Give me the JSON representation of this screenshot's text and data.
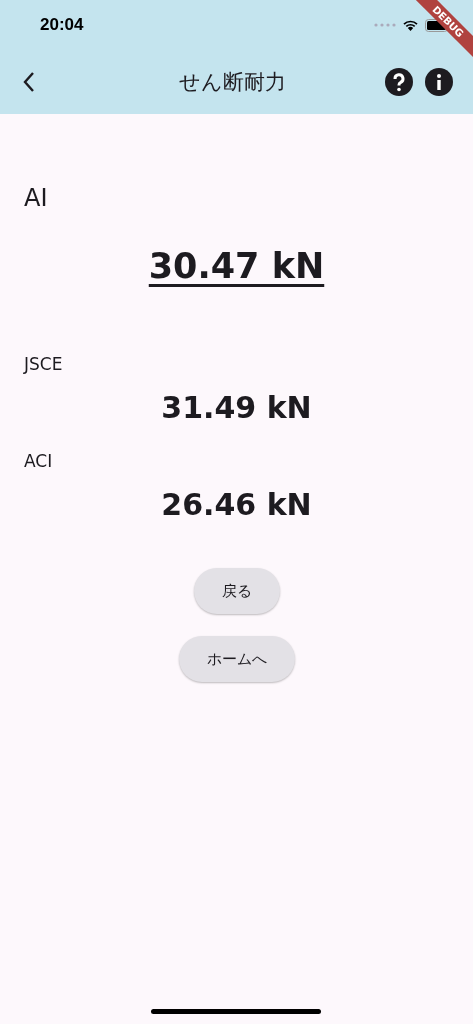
{
  "status_bar": {
    "time": "20:04"
  },
  "debug_banner": "DEBUG",
  "app_bar": {
    "title": "せん断耐力"
  },
  "results": [
    {
      "kind": "primary",
      "label": "AI",
      "value": "30.47 kN"
    },
    {
      "kind": "secondary",
      "label": "JSCE",
      "value": "31.49 kN"
    },
    {
      "kind": "secondary",
      "label": "ACI",
      "value": "26.46 kN"
    }
  ],
  "buttons": [
    "戻る",
    "ホームへ"
  ]
}
